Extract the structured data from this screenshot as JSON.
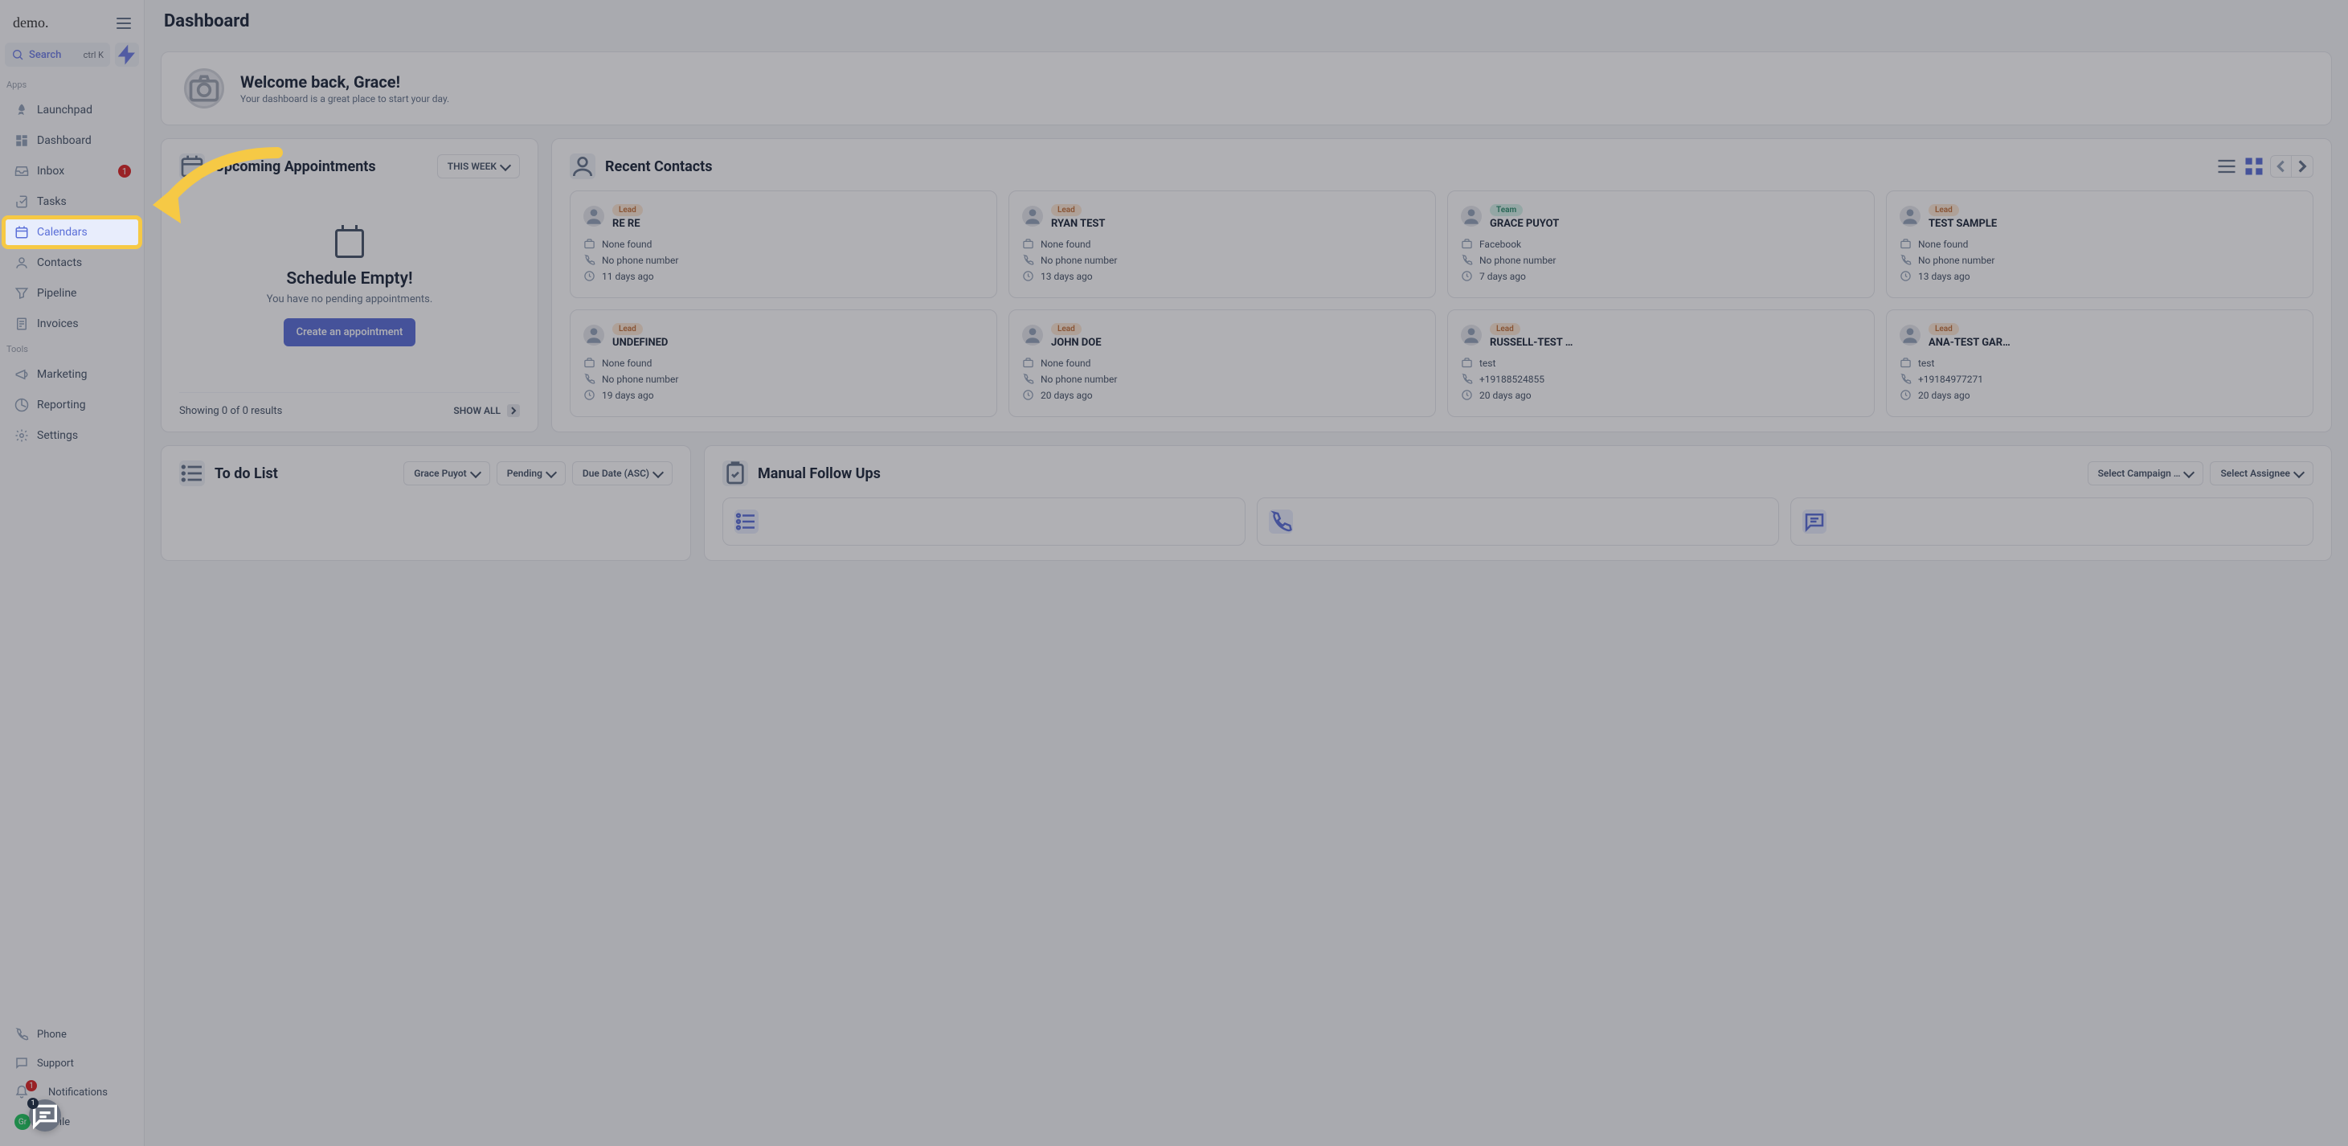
{
  "logo": "demo.",
  "page_title": "Dashboard",
  "search": {
    "label": "Search",
    "shortcut": "ctrl K"
  },
  "sidebar": {
    "section_apps": "Apps",
    "section_tools": "Tools",
    "items": [
      {
        "label": "Launchpad"
      },
      {
        "label": "Dashboard"
      },
      {
        "label": "Inbox",
        "badge": "1"
      },
      {
        "label": "Tasks"
      },
      {
        "label": "Calendars"
      },
      {
        "label": "Contacts"
      },
      {
        "label": "Pipeline"
      },
      {
        "label": "Invoices"
      }
    ],
    "tools": [
      {
        "label": "Marketing"
      },
      {
        "label": "Reporting"
      },
      {
        "label": "Settings"
      }
    ],
    "bottom": [
      {
        "label": "Phone"
      },
      {
        "label": "Support"
      },
      {
        "label": "Notifications",
        "badge": "1"
      },
      {
        "label": "Profile",
        "initials": "Gr"
      }
    ]
  },
  "welcome": {
    "title": "Welcome back, Grace!",
    "subtitle": "Your dashboard is a great place to start your day."
  },
  "appointments": {
    "title": "Upcoming Appointments",
    "range": "THIS WEEK",
    "empty_title": "Schedule Empty!",
    "empty_msg": "You have no pending appointments.",
    "button": "Create an appointment",
    "showing": "Showing 0 of 0 results",
    "show_all": "SHOW ALL"
  },
  "contacts": {
    "title": "Recent Contacts",
    "cards": [
      {
        "tag": "Lead",
        "tagClass": "lead",
        "name": "RE RE",
        "company": "None found",
        "phone": "No phone number",
        "time": "11 days ago"
      },
      {
        "tag": "Lead",
        "tagClass": "lead",
        "name": "RYAN TEST",
        "company": "None found",
        "phone": "No phone number",
        "time": "13 days ago"
      },
      {
        "tag": "Team",
        "tagClass": "team",
        "name": "GRACE PUYOT",
        "company": "Facebook",
        "phone": "No phone number",
        "time": "7 days ago"
      },
      {
        "tag": "Lead",
        "tagClass": "lead",
        "name": "TEST SAMPLE",
        "company": "None found",
        "phone": "No phone number",
        "time": "13 days ago"
      },
      {
        "tag": "Lead",
        "tagClass": "lead",
        "name": "UNDEFINED",
        "company": "None found",
        "phone": "No phone number",
        "time": "19 days ago"
      },
      {
        "tag": "Lead",
        "tagClass": "lead",
        "name": "JOHN DOE",
        "company": "None found",
        "phone": "No phone number",
        "time": "20 days ago"
      },
      {
        "tag": "Lead",
        "tagClass": "lead",
        "name": "RUSSELL-TEST …",
        "company": "test",
        "phone": "+19188524855",
        "time": "20 days ago"
      },
      {
        "tag": "Lead",
        "tagClass": "lead",
        "name": "ANA-TEST GAR…",
        "company": "test",
        "phone": "+19184977271",
        "time": "20 days ago"
      }
    ]
  },
  "todo": {
    "title": "To do List",
    "filter_user": "Grace Puyot",
    "filter_status": "Pending",
    "filter_sort": "Due Date (ASC)"
  },
  "followups": {
    "title": "Manual Follow Ups",
    "filter_campaign": "Select Campaign …",
    "filter_assignee": "Select Assignee"
  }
}
